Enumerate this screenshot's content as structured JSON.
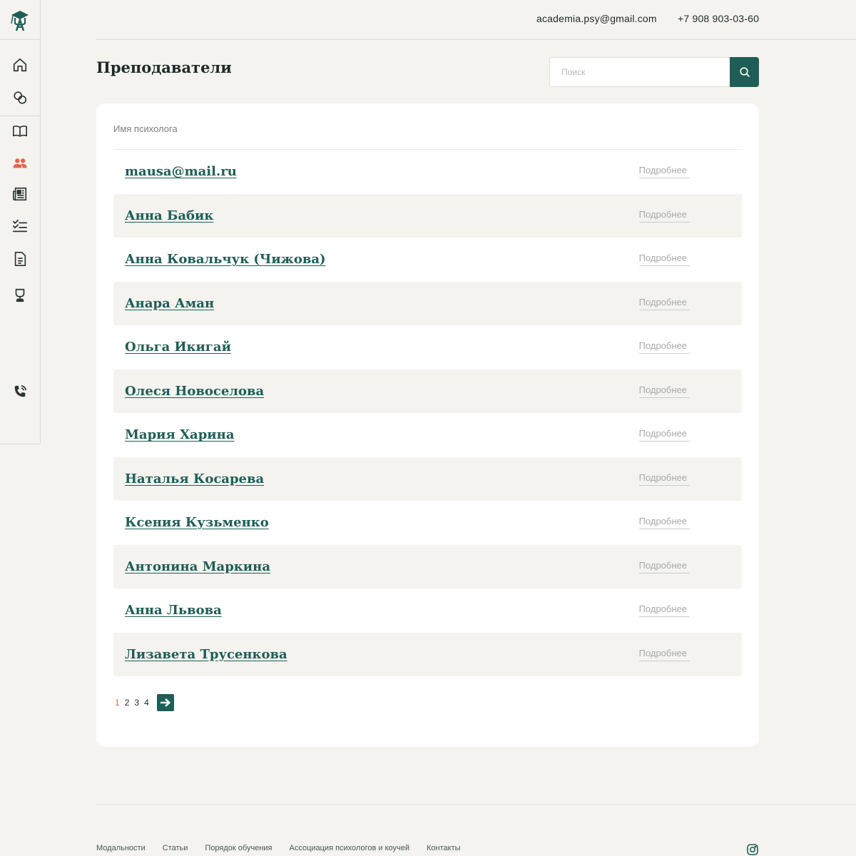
{
  "colors": {
    "accent": "#1f5e56",
    "active_icon": "#e0674a",
    "background": "#f4f3ef",
    "card": "#ffffff"
  },
  "sidebar": {
    "logo_icon": "academy-logo-icon",
    "items": [
      {
        "icon": "home-icon"
      },
      {
        "icon": "chat-bubbles-icon"
      },
      {
        "icon": "open-book-icon"
      },
      {
        "icon": "users-icon",
        "active": true
      },
      {
        "icon": "newspaper-icon"
      },
      {
        "icon": "checklist-icon"
      },
      {
        "icon": "document-icon"
      },
      {
        "icon": "trophy-icon"
      },
      {
        "icon": "phone-call-icon"
      }
    ]
  },
  "header": {
    "email": "academia.psy@gmail.com",
    "phone": "+7 908 903-03-60"
  },
  "page": {
    "title": "Преподаватели"
  },
  "search": {
    "placeholder": "Поиск",
    "value": ""
  },
  "table": {
    "column_header": "Имя психолога",
    "more_label": "Подробнее",
    "rows": [
      {
        "name": "mausa@mail.ru"
      },
      {
        "name": "Анна Бабик"
      },
      {
        "name": "Анна Ковальчук (Чижова)"
      },
      {
        "name": "Анара Аман"
      },
      {
        "name": "Ольга Икигай"
      },
      {
        "name": "Олеся Новоселова"
      },
      {
        "name": "Мария Харина"
      },
      {
        "name": "Наталья Косарева"
      },
      {
        "name": "Ксения Кузьменко"
      },
      {
        "name": "Антонина Маркина"
      },
      {
        "name": "Анна Львова"
      },
      {
        "name": "Лизавета Трусенкова"
      }
    ]
  },
  "pagination": {
    "pages": [
      "1",
      "2",
      "3",
      "4"
    ],
    "current": "1"
  },
  "footer": {
    "links": [
      "Модальности",
      "Статьи",
      "Порядок обучения",
      "Ассоциация психологов и коучей",
      "Контакты"
    ]
  }
}
